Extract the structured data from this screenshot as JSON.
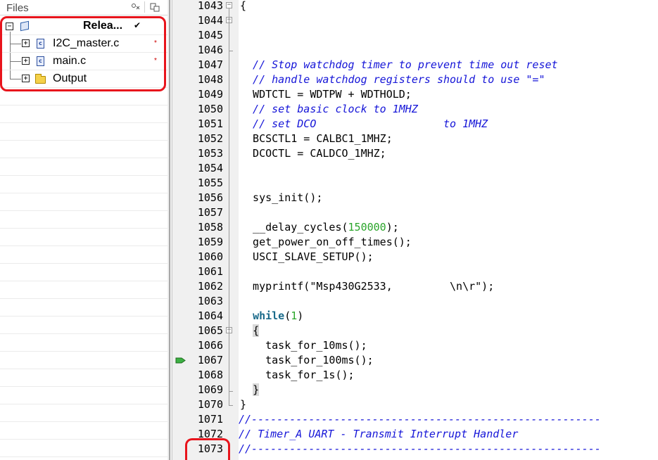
{
  "files_panel": {
    "title": "Files",
    "header_icons": [
      "settings-icon",
      "options-icon"
    ],
    "project": {
      "label": "Relea...",
      "status_icon": "checkmark-icon"
    },
    "items": [
      {
        "label": "I2C_master.c",
        "icon": "c-file-icon",
        "modified": "*"
      },
      {
        "label": "main.c",
        "icon": "c-file-icon",
        "modified": "*"
      },
      {
        "label": "Output",
        "icon": "folder-icon",
        "modified": ""
      }
    ]
  },
  "editor": {
    "current_line_marker": "1067",
    "highlighted_line": "1073",
    "lines": [
      {
        "num": "1043",
        "text": "{"
      },
      {
        "num": "1044",
        "text": ""
      },
      {
        "num": "1045",
        "text": ""
      },
      {
        "num": "1046",
        "text": ""
      },
      {
        "num": "1047",
        "text": "  // Stop watchdog timer to prevent time out reset",
        "kind": "comment"
      },
      {
        "num": "1048",
        "text": "  // handle watchdog registers should to use \"=\"",
        "kind": "comment"
      },
      {
        "num": "1049",
        "text": "  WDTCTL = WDTPW + WDTHOLD;"
      },
      {
        "num": "1050",
        "text": "  // set basic clock to 1MHZ",
        "kind": "comment"
      },
      {
        "num": "1051",
        "text": "  // set DCO                    to 1MHZ",
        "kind": "comment"
      },
      {
        "num": "1052",
        "text": "  BCSCTL1 = CALBC1_1MHZ;"
      },
      {
        "num": "1053",
        "text": "  DCOCTL = CALDCO_1MHZ;"
      },
      {
        "num": "1054",
        "text": ""
      },
      {
        "num": "1055",
        "text": ""
      },
      {
        "num": "1056",
        "text": "  sys_init();"
      },
      {
        "num": "1057",
        "text": ""
      },
      {
        "num": "1058",
        "pre": "  __delay_cycles(",
        "num_literal": "150000",
        "post": ");"
      },
      {
        "num": "1059",
        "text": "  get_power_on_off_times();"
      },
      {
        "num": "1060",
        "text": "  USCI_SLAVE_SETUP();"
      },
      {
        "num": "1061",
        "text": ""
      },
      {
        "num": "1062",
        "text": "  myprintf(\"Msp430G2533,         \\n\\r\");"
      },
      {
        "num": "1063",
        "text": ""
      },
      {
        "num": "1064",
        "kw": "while",
        "pre2": "(",
        "num_literal": "1",
        "post": ")"
      },
      {
        "num": "1065",
        "text": "  {"
      },
      {
        "num": "1066",
        "text": "    task_for_10ms();"
      },
      {
        "num": "1067",
        "text": "    task_for_100ms();"
      },
      {
        "num": "1068",
        "text": "    task_for_1s();"
      },
      {
        "num": "1069",
        "text": "  }"
      },
      {
        "num": "1070",
        "text": "}"
      },
      {
        "num": "1071",
        "text": "//-------------------------------------------------------",
        "kind": "comment"
      },
      {
        "num": "1072",
        "text": "// Timer_A UART - Transmit Interrupt Handler",
        "kind": "comment"
      },
      {
        "num": "1073",
        "text": "//-------------------------------------------------------",
        "kind": "comment"
      }
    ]
  },
  "colors": {
    "comment": "#1515d8",
    "number": "#2aa52a",
    "keyword": "#1a6a8a",
    "highlight_box": "#e8141c",
    "gutter": "#f0f0f0",
    "breakpoint_arrow": "#3cb043"
  }
}
